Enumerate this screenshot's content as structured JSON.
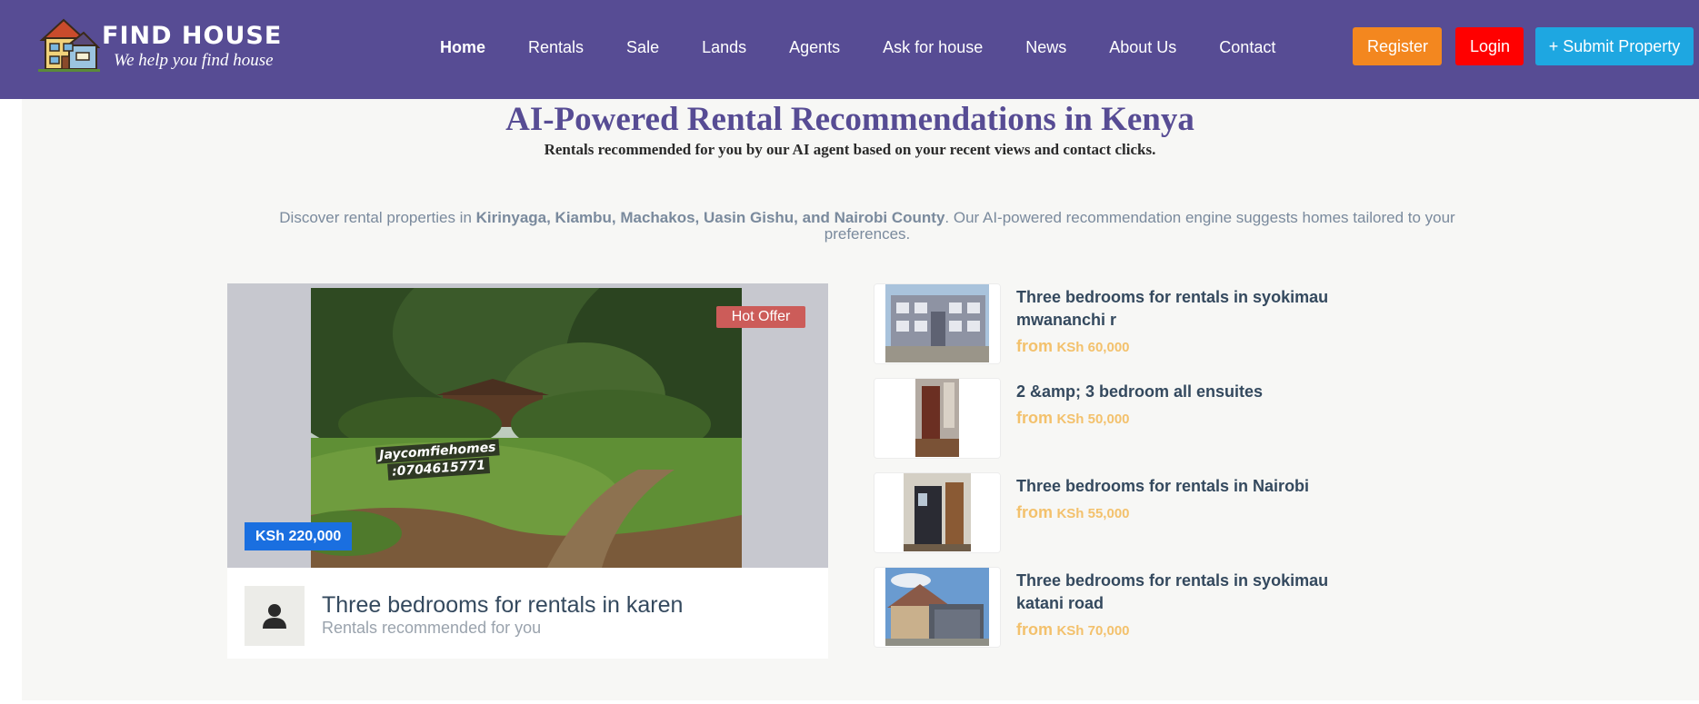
{
  "brand": {
    "title": "FIND HOUSE",
    "tagline": "We help you find house"
  },
  "nav": [
    {
      "label": "Home",
      "active": true
    },
    {
      "label": "Rentals"
    },
    {
      "label": "Sale"
    },
    {
      "label": "Lands"
    },
    {
      "label": "Agents"
    },
    {
      "label": "Ask for house"
    },
    {
      "label": "News"
    },
    {
      "label": "About Us"
    },
    {
      "label": "Contact"
    }
  ],
  "actions": {
    "register": "Register",
    "login": "Login",
    "submit": "+ Submit Property"
  },
  "hero": {
    "title": "AI-Powered Rental Recommendations in Kenya",
    "subtitle": "Rentals recommended for you by our AI agent based on your recent views and contact clicks."
  },
  "intro": {
    "prefix": "Discover rental properties in ",
    "counties": "Kirinyaga, Kiambu, Machakos, Uasin Gishu, and Nairobi County",
    "suffix": ". Our AI-powered recommendation engine suggests homes tailored to your preferences."
  },
  "featured": {
    "badge": "Hot Offer",
    "price": "KSh 220,000",
    "watermark_name": "Jaycomfiehomes",
    "watermark_phone": ":0704615771",
    "title": "Three bedrooms for rentals in karen",
    "caption": "Rentals recommended for you"
  },
  "listings": [
    {
      "title": "Three bedrooms for rentals in syokimau mwananchi r",
      "from": "from",
      "price": "KSh 60,000"
    },
    {
      "title": "2 &amp; 3 bedroom all ensuites",
      "from": "from",
      "price": "KSh 50,000"
    },
    {
      "title": "Three bedrooms for rentals in Nairobi",
      "from": "from",
      "price": "KSh 55,000"
    },
    {
      "title": "Three bedrooms for rentals in syokimau katani road",
      "from": "from",
      "price": "KSh 70,000"
    }
  ],
  "colors": {
    "header": "#574c94",
    "register": "#f3871f",
    "login": "#ff0000",
    "submit": "#1ea7e1",
    "hot_offer": "#cc5c59",
    "price_badge": "#1a6fe0",
    "price_text": "#f3c16c"
  }
}
